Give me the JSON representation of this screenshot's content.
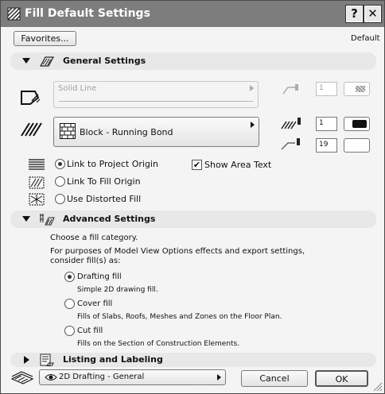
{
  "window": {
    "title": "Fill Default Settings"
  },
  "titlebar": {
    "help_label": "?",
    "close_label": "✕"
  },
  "top": {
    "favorites_label": "Favorites...",
    "default_label": "Default"
  },
  "general": {
    "title": "General Settings",
    "line_type": "Solid Line",
    "line_pen": "1",
    "fill_pattern": "Block - Running Bond",
    "fg_pen": "1",
    "bg_pen": "19",
    "origin_options": [
      "Link to Project Origin",
      "Link To Fill Origin",
      "Use Distorted Fill"
    ],
    "origin_selected": 0,
    "show_area_text": "Show Area Text",
    "show_area_text_checked": true
  },
  "advanced": {
    "title": "Advanced Settings",
    "intro": "Choose a fill category.",
    "note_line1": "For purposes of Model View Options effects and export settings,",
    "note_line2": "consider fill(s) as:",
    "categories": [
      {
        "label": "Drafting fill",
        "desc": "Simple 2D drawing fill."
      },
      {
        "label": "Cover fill",
        "desc": "Fills of Slabs, Roofs, Meshes and Zones on the Floor Plan."
      },
      {
        "label": "Cut fill",
        "desc": "Fills on the Section of Construction Elements."
      }
    ],
    "category_selected": 0
  },
  "listing": {
    "title": "Listing and Labeling"
  },
  "bottom": {
    "layer": "2D Drafting - General",
    "cancel_label": "Cancel",
    "ok_label": "OK"
  },
  "icons": {
    "title": "fill-settings-icon",
    "general": "fill-hatch-icon",
    "advanced": "advanced-fill-icon",
    "listing": "listing-icon",
    "line": "line-type-icon",
    "pattern": "fill-pattern-icon",
    "layer": "layer-icon",
    "visibility": "eye-icon"
  }
}
